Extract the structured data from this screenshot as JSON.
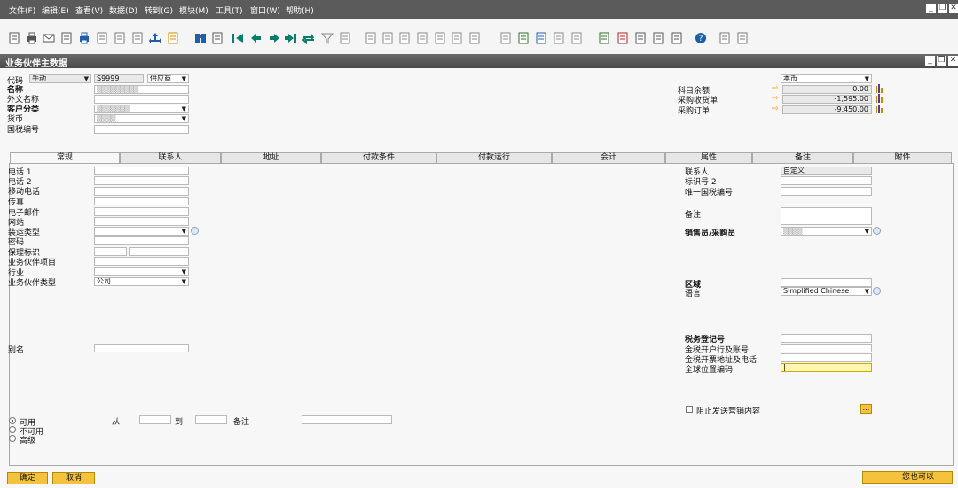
{
  "menu": [
    "文件(F)",
    "编辑(E)",
    "查看(V)",
    "数据(D)",
    "转到(G)",
    "模块(M)",
    "工具(T)",
    "窗口(W)",
    "帮助(H)"
  ],
  "window": {
    "title": "业务伙伴主数据"
  },
  "header_left": {
    "code_label": "代码",
    "code_mode": "手动",
    "code_value": "S9999",
    "type_value": "供应商",
    "name_label": "名称",
    "foreign_name_label": "外文名称",
    "group_label": "客户分类",
    "currency_label": "货币",
    "tax_id_label": "国税编号"
  },
  "header_right": {
    "currency_select": "本币",
    "balance_label": "科目余额",
    "balance_value": "0.00",
    "receipts_label": "采购收货单",
    "receipts_value": "-1,595.00",
    "orders_label": "采购订单",
    "orders_value": "-9,450.00"
  },
  "tabs": [
    "常规",
    "联系人",
    "地址",
    "付款条件",
    "付款运行",
    "会计",
    "属性",
    "备注",
    "附件"
  ],
  "general_left": {
    "phone1": "电话 1",
    "phone2": "电话 2",
    "mobile": "移动电话",
    "fax": "传真",
    "email": "电子邮件",
    "website": "网站",
    "shipping_type": "装运类型",
    "password": "密码",
    "factoring": "保理标识",
    "bp_project": "业务伙伴项目",
    "industry": "行业",
    "bp_type": "业务伙伴类型",
    "bp_type_value": "公司",
    "alias": "别名"
  },
  "general_right": {
    "contact_person": "联系人",
    "contact_value": "自定义",
    "id_no2": "标识号 2",
    "unique_tax_no": "唯一国税编号",
    "remarks": "备注",
    "sales_employee": "销售员/采购员",
    "territory": "区域",
    "language": "语言",
    "language_value": "Simplified Chinese",
    "tax_reg_no": "税务登记号",
    "tax_bank_account": "金税开户行及账号",
    "tax_invoice_addr": "金税开票地址及电话",
    "gln": "全球位置编码",
    "block_marketing": "阻止发送营销内容",
    "ellipsis": "..."
  },
  "status": {
    "active": "可用",
    "inactive": "不可用",
    "advanced": "高级",
    "from": "从",
    "to": "到",
    "remarks": "备注"
  },
  "buttons": {
    "ok": "确定",
    "cancel": "取消",
    "also_can": "您也可以"
  },
  "colors": {
    "menubar": "#5b5b5b",
    "accent_button": "#f4c23c",
    "arrow": "#f1a000"
  }
}
